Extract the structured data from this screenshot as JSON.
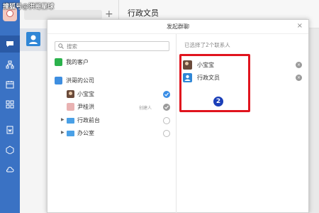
{
  "watermark": "搜狐号@洪哥星球",
  "chat_header": {
    "title": "行政文员"
  },
  "modal": {
    "title": "发起群聊",
    "close_glyph": "×",
    "search_placeholder": "搜索",
    "groups": {
      "my_customers": "我的客户",
      "company": "洪哥的公司"
    },
    "members": [
      {
        "name": "小宝宝",
        "state": "checked"
      },
      {
        "name": "尹桂洪",
        "tag": "创建人",
        "state": "fixed"
      }
    ],
    "departments": [
      {
        "name": "行政前台",
        "arrow": "▶"
      },
      {
        "name": "办公室",
        "arrow": "▶"
      }
    ],
    "selected": {
      "count_text": "已选择了2个联系人",
      "items": [
        {
          "name": "小宝宝",
          "remove": "×"
        },
        {
          "name": "行政文员",
          "remove": "×"
        }
      ]
    }
  },
  "annotation": {
    "step": "2",
    "highlight_color": "#e0141e",
    "badge_color": "#1b3fb8"
  },
  "colors": {
    "rail": "#3a72c4",
    "accent": "#3a8ee6",
    "wechat": "#2bb24c"
  },
  "icons": [
    "chat-icon",
    "org-icon",
    "calendar-icon",
    "apps-icon",
    "doc-icon",
    "cube-icon",
    "cloud-icon",
    "search-icon",
    "close-icon",
    "wechat-icon",
    "company-icon",
    "folder-icon"
  ]
}
